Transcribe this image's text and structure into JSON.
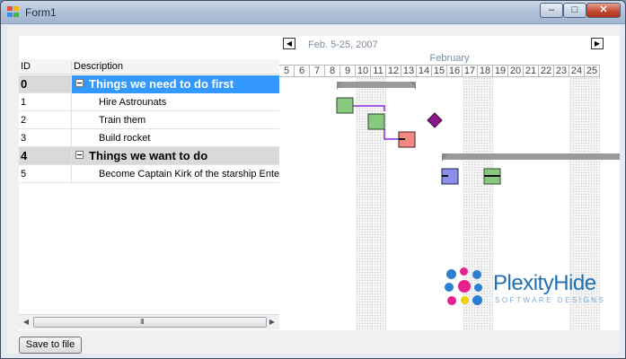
{
  "window": {
    "title": "Form1",
    "minimize_glyph": "‒",
    "maximize_glyph": "□",
    "close_glyph": "✕"
  },
  "grid": {
    "columns": {
      "id": "ID",
      "description": "Description"
    },
    "rows": [
      {
        "id": "0",
        "description": "Things we need to do first",
        "group": true,
        "selected": true
      },
      {
        "id": "1",
        "description": "Hire Astrounats",
        "group": false,
        "selected": false
      },
      {
        "id": "2",
        "description": "Train them",
        "group": false,
        "selected": false
      },
      {
        "id": "3",
        "description": "Build rocket",
        "group": false,
        "selected": false
      },
      {
        "id": "4",
        "description": "Things we want to do",
        "group": true,
        "selected": false
      },
      {
        "id": "5",
        "description": "Become Captain Kirk of the starship Enterprise",
        "group": false,
        "selected": false
      }
    ],
    "scroll_grip": "III"
  },
  "gantt": {
    "range_label": "Feb. 5-25, 2007",
    "month": "February",
    "days": [
      "5",
      "6",
      "7",
      "8",
      "9",
      "10",
      "11",
      "12",
      "13",
      "14",
      "15",
      "16",
      "17",
      "18",
      "19",
      "20",
      "21",
      "22",
      "23",
      "24",
      "25"
    ],
    "weekend_days": [
      "10",
      "11",
      "17",
      "18",
      "24",
      "25"
    ],
    "prev_glyph": "◀",
    "next_glyph": "▶",
    "colors": {
      "group_bar": "#9a9a9a",
      "green_task": "#88c97f",
      "red_task": "#f08a82",
      "blue_task": "#8b8fe8",
      "milestone": "#8b1a8b",
      "link": "#8b2be2"
    }
  },
  "logo": {
    "name": "PlexityHide",
    "tagline": "SOFTWARE DESIGNS"
  },
  "footer": {
    "save_label": "Save to file"
  }
}
